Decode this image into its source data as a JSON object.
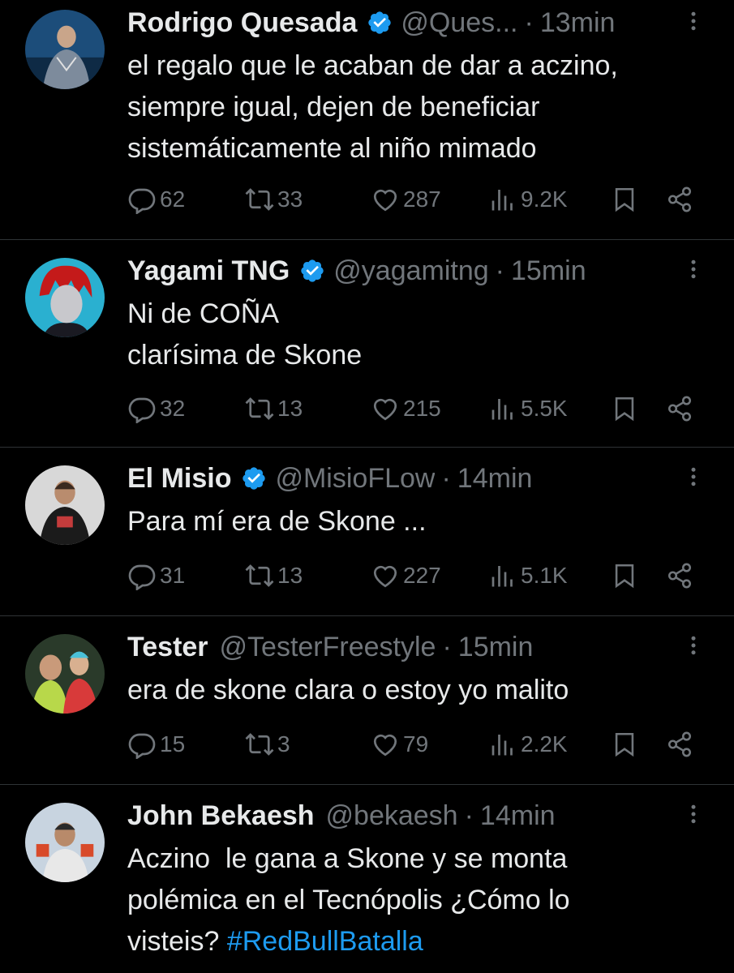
{
  "tweets": [
    {
      "name": "Rodrigo Quesada",
      "verified": true,
      "handle": "@Ques...",
      "time": "13min",
      "lines": [
        "el regalo que le acaban de dar a aczino,",
        "siempre igual, dejen de beneficiar",
        "sistemáticamente al niño mimado"
      ],
      "replies": "62",
      "retweets": "33",
      "likes": "287",
      "views": "9.2K"
    },
    {
      "name": "Yagami TNG",
      "verified": true,
      "handle": "@yagamitng",
      "time": "15min",
      "lines": [
        "Ni de COÑA",
        "clarísima de Skone"
      ],
      "replies": "32",
      "retweets": "13",
      "likes": "215",
      "views": "5.5K"
    },
    {
      "name": "El Misio",
      "verified": true,
      "handle": "@MisioFLow",
      "time": "14min",
      "lines": [
        "Para mí era de Skone ..."
      ],
      "replies": "31",
      "retweets": "13",
      "likes": "227",
      "views": "5.1K"
    },
    {
      "name": "Tester",
      "verified": false,
      "handle": "@TesterFreestyle",
      "time": "15min",
      "lines": [
        "era de skone clara o estoy yo malito"
      ],
      "replies": "15",
      "retweets": "3",
      "likes": "79",
      "views": "2.2K"
    },
    {
      "name": "John Bekaesh",
      "verified": false,
      "handle": "@bekaesh",
      "time": "14min",
      "lines": [
        "Aczino  le gana a Skone y se monta",
        "polémica en el Tecnópolis ¿Cómo lo",
        "visteis?"
      ],
      "hashtag": "#RedBullBatalla"
    }
  ],
  "separator": "·",
  "colors": {
    "background": "#000000",
    "text": "#e7e9ea",
    "muted": "#71767b",
    "accent": "#1d9bf0",
    "divider": "#2f3336"
  },
  "icons": [
    "reply-icon",
    "retweet-icon",
    "like-icon",
    "views-icon",
    "bookmark-icon",
    "share-icon",
    "more-icon",
    "verified-badge-icon"
  ]
}
